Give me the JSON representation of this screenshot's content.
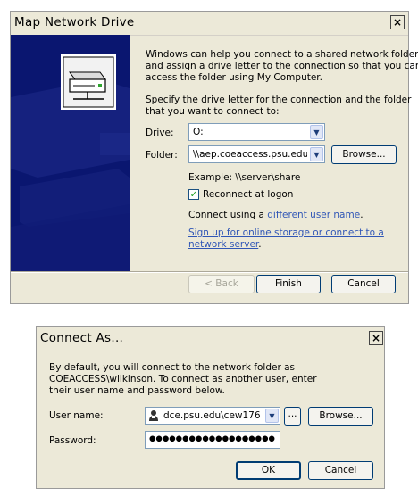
{
  "map_drive": {
    "title": "Map Network Drive",
    "close_glyph": "×",
    "intro_lines": [
      "Windows can help you connect to a shared network folder",
      "and assign a drive letter to the connection so that you can",
      "access the folder using My Computer."
    ],
    "specify_lines": [
      "Specify the drive letter for the connection and the folder",
      "that you want to connect to:"
    ],
    "drive_label": "Drive:",
    "drive_value": "O:",
    "folder_label": "Folder:",
    "folder_value": "\\\\aep.coeaccess.psu.edu\\",
    "browse_label": "Browse...",
    "example_text": "Example: \\\\server\\share",
    "reconnect_label": "Reconnect at logon",
    "reconnect_checked": true,
    "connect_using_prefix": "Connect using a ",
    "different_user_link": "different user name",
    "connect_using_suffix": ".",
    "signup_line1": "Sign up for online storage or connect to a",
    "signup_line2": "network server",
    "signup_suffix": ".",
    "back_label": "< Back",
    "finish_label": "Finish",
    "cancel_label": "Cancel"
  },
  "connect_as": {
    "title": "Connect As...",
    "close_glyph": "×",
    "desc_lines": [
      "By default, you will connect to the network folder as",
      "COEACCESS\\wilkinson. To connect as another user, enter",
      "their user name and password below."
    ],
    "username_label": "User name:",
    "username_value": "dce.psu.edu\\cew176",
    "ellipsis_label": "...",
    "browse_label": "Browse...",
    "password_label": "Password:",
    "password_value": "●●●●●●●●●●●●●●●●●●●",
    "ok_label": "OK",
    "cancel_label": "Cancel"
  },
  "icons": {
    "dropdown": "▼",
    "check": "✓",
    "user": "user-icon"
  },
  "colors": {
    "dialog_bg": "#ece9d8",
    "panel_blue": "#0a1670",
    "link_blue": "#3056b6",
    "button_border": "#003c74"
  }
}
